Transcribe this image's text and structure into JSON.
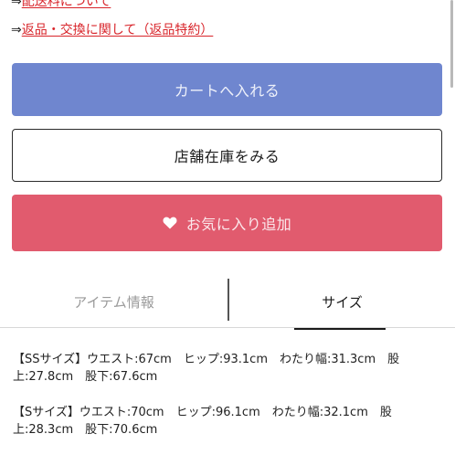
{
  "links": [
    {
      "arrow": "⇒",
      "label": "配送料について"
    },
    {
      "arrow": "⇒",
      "label": "返品・交換に関して（返品特約）"
    }
  ],
  "buttons": {
    "cart_label": "カートへ入れる",
    "stock_label": "店舗在庫をみる",
    "favorite_label": "お気に入り追加"
  },
  "tabs": [
    {
      "label": "アイテム情報",
      "active": false
    },
    {
      "label": "サイズ",
      "active": true
    }
  ],
  "sizes": [
    {
      "line1": "【SSサイズ】ウエスト:67cm　ヒップ:93.1cm　わたり幅:31.3cm　股",
      "line2": "上:27.8cm　股下:67.6cm"
    },
    {
      "line1": "【Sサイズ】ウエスト:70cm　ヒップ:96.1cm　わたり幅:32.1cm　股",
      "line2": "上:28.3cm　股下:70.6cm"
    }
  ],
  "colors": {
    "link": "#d8242a",
    "cart_button": "#6f86cf",
    "favorite_button": "#e15b6e",
    "stock_border": "#2b2b2b"
  },
  "icons": {
    "favorite": "heart-icon"
  }
}
